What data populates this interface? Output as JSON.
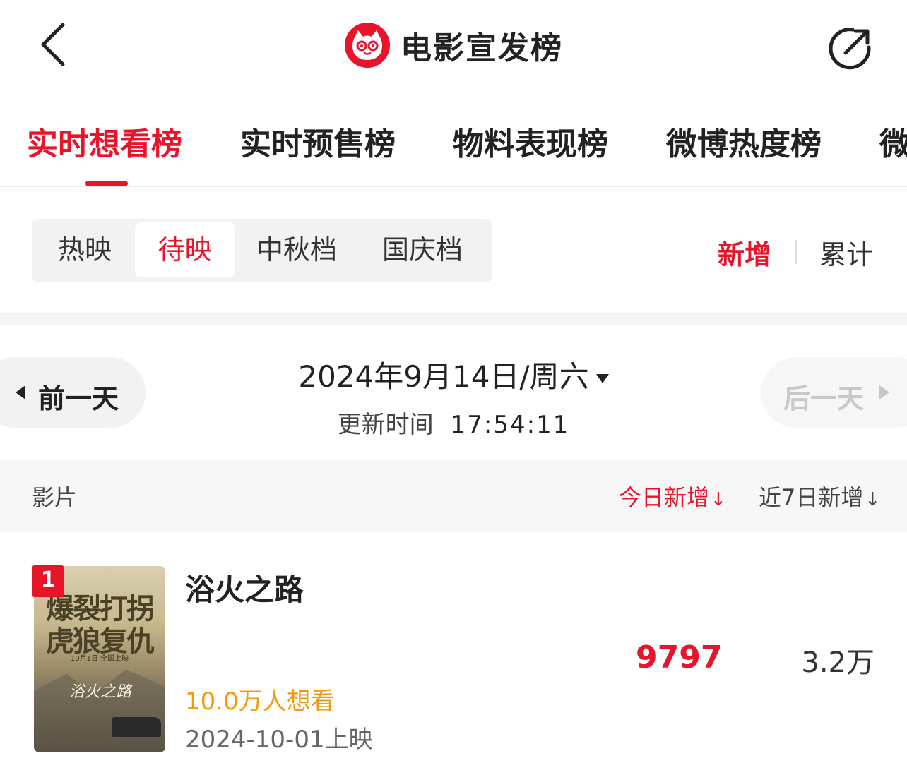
{
  "header": {
    "title": "电影宣发榜",
    "back_icon": "chevron-left-icon",
    "share_icon": "share-icon",
    "logo": "maoyan-cat-logo"
  },
  "tabs": [
    {
      "label": "实时想看榜",
      "active": true
    },
    {
      "label": "实时预售榜",
      "active": false
    },
    {
      "label": "物料表现榜",
      "active": false
    },
    {
      "label": "微博热度榜",
      "active": false
    },
    {
      "label": "微",
      "active": false
    }
  ],
  "segments": [
    {
      "label": "热映",
      "active": false
    },
    {
      "label": "待映",
      "active": true
    },
    {
      "label": "中秋档",
      "active": false
    },
    {
      "label": "国庆档",
      "active": false
    }
  ],
  "sort": {
    "new_label": "新增",
    "total_label": "累计",
    "active": "新增"
  },
  "date_nav": {
    "prev_label": "前一天",
    "next_label": "后一天",
    "date": "2024年9月14日/周六",
    "update_label": "更新时间",
    "update_time": "17:54:11"
  },
  "table": {
    "col_film": "影片",
    "col_today": "今日新增",
    "col_week": "近7日新增",
    "rows": [
      {
        "rank": "1",
        "title": "浴火之路",
        "want": "10.0万人想看",
        "release": "2024-10-01上映",
        "today": "9797",
        "week": "3.2万",
        "poster_text_1": "爆裂打拐",
        "poster_text_2": "虎狼复仇",
        "poster_tagline": "10月1日 全国上映",
        "poster_logo": "浴火之路"
      }
    ]
  },
  "colors": {
    "accent": "#e8142a",
    "want": "#f29a0e"
  }
}
